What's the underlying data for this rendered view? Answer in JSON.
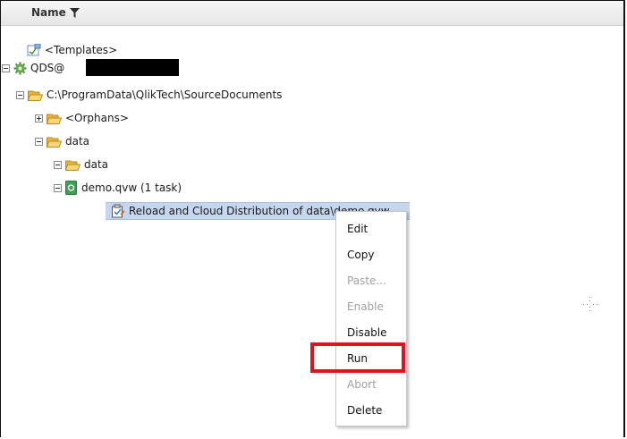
{
  "header": {
    "column_label": "Name"
  },
  "tree": {
    "templates": "<Templates>",
    "server": "QDS@",
    "source_path": "C:\\ProgramData\\QlikTech\\SourceDocuments",
    "orphans": "<Orphans>",
    "data_folder": "data",
    "data_subfolder": "data",
    "document": "demo.qvw (1 task)",
    "task": "Reload and Cloud Distribution of data\\demo.qvw"
  },
  "context_menu": {
    "items": [
      {
        "label": "Edit",
        "enabled": true
      },
      {
        "label": "Copy",
        "enabled": true
      },
      {
        "label": "Paste...",
        "enabled": false
      },
      {
        "label": "Enable",
        "enabled": false
      },
      {
        "label": "Disable",
        "enabled": true
      },
      {
        "label": "Run",
        "enabled": true,
        "highlighted": true
      },
      {
        "label": "Abort",
        "enabled": false
      },
      {
        "label": "Delete",
        "enabled": true
      }
    ]
  },
  "colors": {
    "selection": "#c5d6ee",
    "highlight_border": "#e0141e",
    "folder": "#f2c24a",
    "server_icon": "#6aa84f"
  }
}
